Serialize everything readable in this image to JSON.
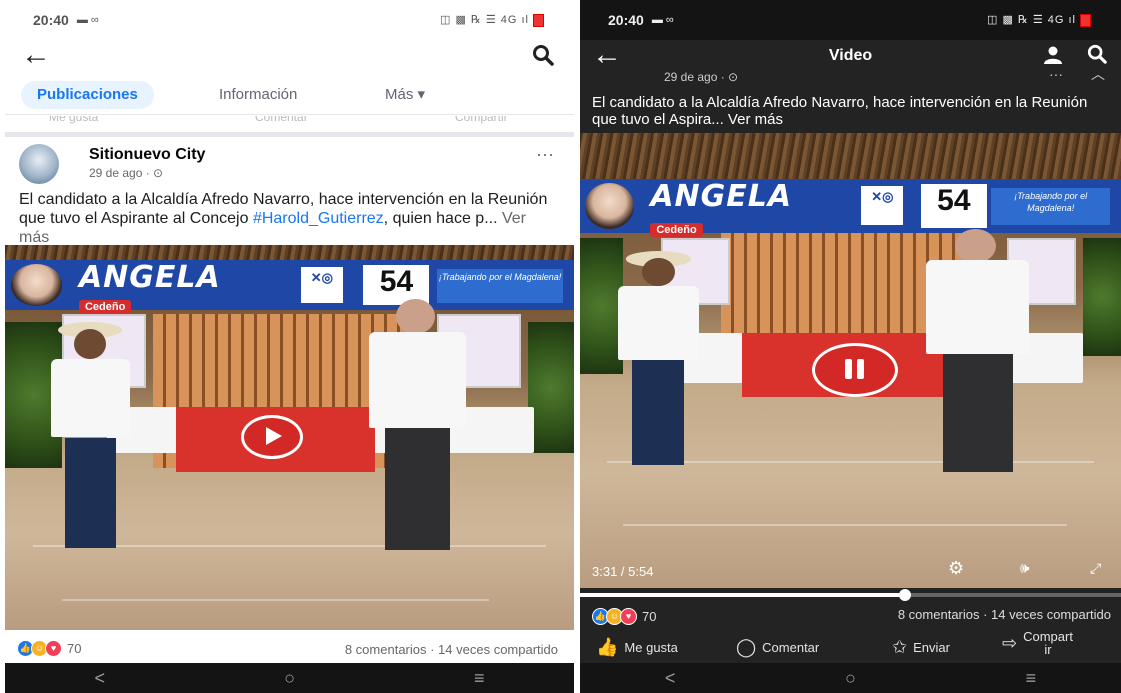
{
  "left": {
    "status": {
      "time": "20:40",
      "notifications": "▬ ∞",
      "system": "◫ ▩ ℞ ☰ 4G ıl"
    },
    "nav": {
      "back_icon": "arrow-left",
      "search_icon": "magnifier"
    },
    "tabs": [
      {
        "label": "Publicaciones",
        "active": true
      },
      {
        "label": "Información",
        "active": false
      },
      {
        "label": "Más ▾",
        "active": false
      }
    ],
    "ghost_actions": [
      "Me gusta",
      "Comentar",
      "Compartir"
    ],
    "post": {
      "page_name": "Sitionuevo City",
      "date": "29 de ago · ⊙",
      "more": "···",
      "text_before": "El candidato a la Alcaldía Afredo Navarro, hace intervención en la Reunión que tuvo el Aspirante al Concejo ",
      "hashtag": "#Harold_Gutierrez",
      "text_after": ", quien hace p...",
      "see_more": "Ver más"
    },
    "video": {
      "banner_name": "ANGELA",
      "banner_sub": "Cedeño",
      "banner_number": "54",
      "banner_tag": "¡Trabajando por el Magdalena!",
      "play_state": "play"
    },
    "reactions": {
      "count": "70",
      "comments": "8 comentarios · 14 veces compartido"
    },
    "navbar": [
      "<",
      "○",
      "≡"
    ]
  },
  "right": {
    "status": {
      "time": "20:40",
      "notifications": "▬ ∞",
      "system": "◫ ▩ ℞ ☰ 4G ıl"
    },
    "header": {
      "title": "Video"
    },
    "post": {
      "date": "29 de ago · ⊙",
      "more": "···",
      "text": "El candidato a la Alcaldía Afredo Navarro, hace intervención en la Reunión que tuvo el Aspira...",
      "see_more": "Ver más"
    },
    "video": {
      "banner_name": "ANGELA",
      "banner_sub": "Cedeño",
      "banner_number": "54",
      "banner_tag": "¡Trabajando por el Magdalena!",
      "play_state": "pause",
      "time": "3:31 / 5:54",
      "progress_fraction": 0.6
    },
    "reactions": {
      "count": "70",
      "comments": "8 comentarios · 14 veces compartido"
    },
    "actions": {
      "like": "Me gusta",
      "comment": "Comentar",
      "send": "Enviar",
      "share_line1": "Compart",
      "share_line2": "ir"
    },
    "navbar": [
      "<",
      "○",
      "≡"
    ]
  },
  "colors": {
    "facebook_blue": "#1877f2",
    "banner_blue": "#1f47a6",
    "cloth_red": "#d9312c",
    "dark_bg": "#232323"
  }
}
